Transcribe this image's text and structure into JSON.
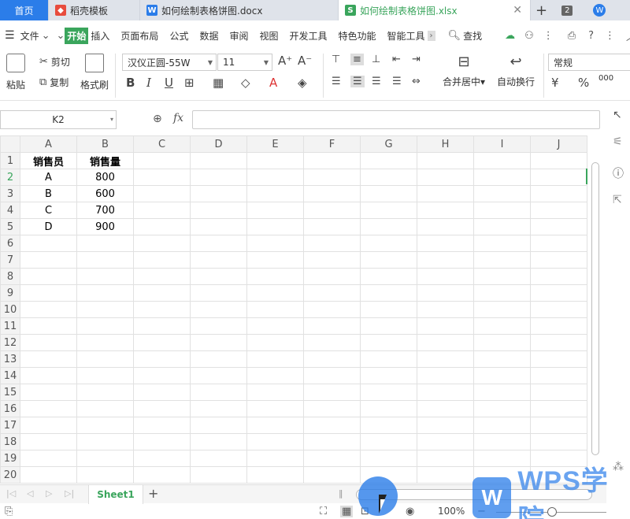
{
  "tabs": {
    "home": "首页",
    "daoke": "稻壳模板",
    "docx": "如何绘制表格饼图.docx",
    "xlsx": "如何绘制表格饼图.xlsx",
    "count": "2"
  },
  "menu": {
    "file": "文件",
    "items": [
      "开始",
      "插入",
      "页面布局",
      "公式",
      "数据",
      "审阅",
      "视图",
      "开发工具",
      "特色功能",
      "智能工具"
    ],
    "search": "查找"
  },
  "ribbon": {
    "paste": "粘贴",
    "cut": "剪切",
    "copy": "复制",
    "format_painter": "格式刷",
    "font_name": "汉仪正圆-55W",
    "font_size": "11",
    "merge_center": "合并居中",
    "wrap_text": "自动换行",
    "number_format": "常规",
    "percent": "%",
    "decimal": "000"
  },
  "formula": {
    "cell_ref": "K2",
    "fx": "fx",
    "value": ""
  },
  "grid": {
    "columns": [
      "A",
      "B",
      "C",
      "D",
      "E",
      "F",
      "G",
      "H",
      "I",
      "J"
    ],
    "rows": [
      "1",
      "2",
      "3",
      "4",
      "5",
      "6",
      "7",
      "8",
      "9",
      "10",
      "11",
      "12",
      "13",
      "14",
      "15",
      "16",
      "17",
      "18",
      "19",
      "20"
    ],
    "header": [
      "销售员",
      "销售量"
    ],
    "data": [
      [
        "A",
        "800"
      ],
      [
        "B",
        "600"
      ],
      [
        "C",
        "700"
      ],
      [
        "D",
        "900"
      ]
    ]
  },
  "sheet": {
    "tab": "Sheet1",
    "add": "+"
  },
  "status": {
    "zoom": "100%"
  },
  "watermark": {
    "logo": "W",
    "text": "WPS学院"
  }
}
